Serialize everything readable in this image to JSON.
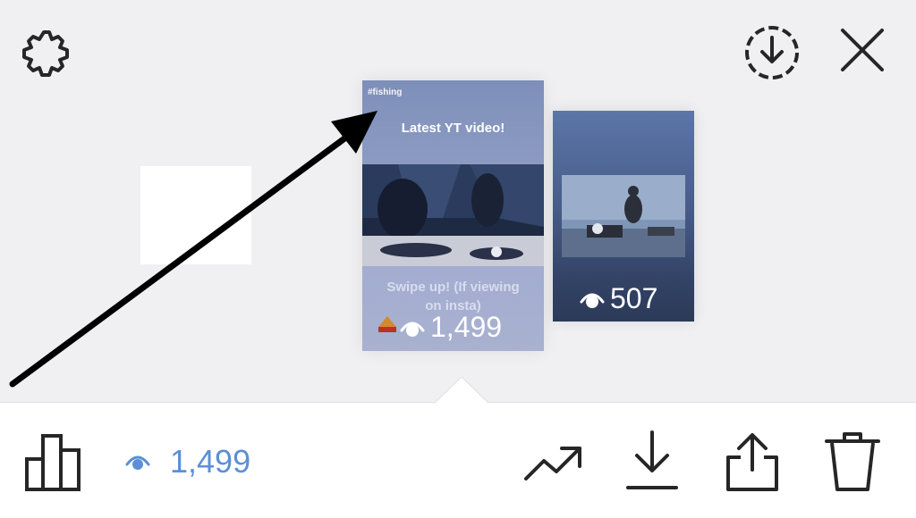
{
  "story_main": {
    "hashtag": "#fishing",
    "headline": "Latest YT video!",
    "swipe_text_line1": "Swipe up! (If viewing",
    "swipe_text_line2": "on insta)",
    "views": "1,499"
  },
  "story_second": {
    "views": "507"
  },
  "bottom_bar": {
    "viewer_count": "1,499"
  },
  "icons": {
    "settings": "gear-icon",
    "save_story": "download-circle-icon",
    "close": "close-icon",
    "insights": "bar-chart-icon",
    "viewers": "eye-icon",
    "promote": "trending-up-icon",
    "download": "download-icon",
    "share": "share-icon",
    "delete": "trash-icon"
  },
  "colors": {
    "accent": "#5b8fd6",
    "icon": "#262626",
    "background": "#f0f0f2"
  }
}
